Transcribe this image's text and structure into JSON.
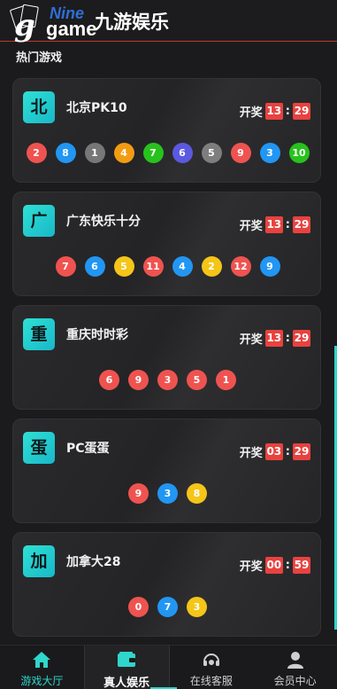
{
  "header": {
    "logo_nine": "Nine",
    "logo_game": "game",
    "logo_cn": "九游娱乐"
  },
  "section_title": "热门游戏",
  "colors": {
    "accent": "#2fd6cc",
    "timer_bg": "#e8423f"
  },
  "games": [
    {
      "badge": "北",
      "name": "北京PK10",
      "draw_label": "开奖",
      "timer": [
        "13",
        "29"
      ],
      "balls": [
        {
          "n": "2",
          "color": "#ef5350"
        },
        {
          "n": "8",
          "color": "#2196f3"
        },
        {
          "n": "1",
          "color": "#777777"
        },
        {
          "n": "4",
          "color": "#f39c12"
        },
        {
          "n": "7",
          "color": "#27c31c"
        },
        {
          "n": "6",
          "color": "#5b59e0"
        },
        {
          "n": "5",
          "color": "#7e7e7e"
        },
        {
          "n": "9",
          "color": "#ef5350"
        },
        {
          "n": "3",
          "color": "#2196f3"
        },
        {
          "n": "10",
          "color": "#27c31c"
        }
      ]
    },
    {
      "badge": "广",
      "name": "广东快乐十分",
      "draw_label": "开奖",
      "timer": [
        "13",
        "29"
      ],
      "balls": [
        {
          "n": "7",
          "color": "#ef5350"
        },
        {
          "n": "6",
          "color": "#2196f3"
        },
        {
          "n": "5",
          "color": "#f5c518"
        },
        {
          "n": "11",
          "color": "#ef5350"
        },
        {
          "n": "4",
          "color": "#2196f3"
        },
        {
          "n": "2",
          "color": "#f5c518"
        },
        {
          "n": "12",
          "color": "#ef5350"
        },
        {
          "n": "9",
          "color": "#2196f3"
        }
      ]
    },
    {
      "badge": "重",
      "name": "重庆时时彩",
      "draw_label": "开奖",
      "timer": [
        "13",
        "29"
      ],
      "balls": [
        {
          "n": "6",
          "color": "#ef5350"
        },
        {
          "n": "9",
          "color": "#ef5350"
        },
        {
          "n": "3",
          "color": "#ef5350"
        },
        {
          "n": "5",
          "color": "#ef5350"
        },
        {
          "n": "1",
          "color": "#ef5350"
        }
      ]
    },
    {
      "badge": "蛋",
      "name": "PC蛋蛋",
      "draw_label": "开奖",
      "timer": [
        "03",
        "29"
      ],
      "balls": [
        {
          "n": "9",
          "color": "#ef5350"
        },
        {
          "n": "3",
          "color": "#2196f3"
        },
        {
          "n": "8",
          "color": "#f5c518"
        }
      ]
    },
    {
      "badge": "加",
      "name": "加拿大28",
      "draw_label": "开奖",
      "timer": [
        "00",
        "59"
      ],
      "balls": [
        {
          "n": "0",
          "color": "#ef5350"
        },
        {
          "n": "7",
          "color": "#2196f3"
        },
        {
          "n": "3",
          "color": "#f5c518"
        }
      ]
    }
  ],
  "nav": [
    {
      "label": "游戏大厅",
      "icon": "home-icon"
    },
    {
      "label": "真人娱乐",
      "icon": "wallet-icon"
    },
    {
      "label": "在线客服",
      "icon": "headset-icon"
    },
    {
      "label": "会员中心",
      "icon": "user-icon"
    }
  ]
}
